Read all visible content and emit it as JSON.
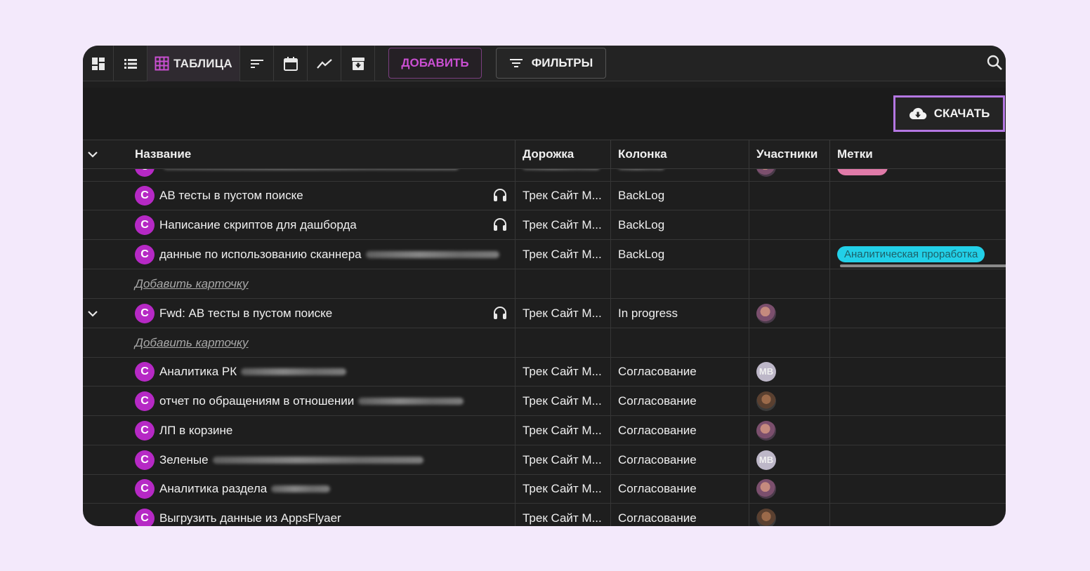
{
  "toolbar": {
    "table_label": "ТАБЛИЦА",
    "add_label": "ДОБАВИТЬ",
    "filters_label": "ФИЛЬТРЫ"
  },
  "download_label": "СКАЧАТЬ",
  "columns": {
    "name": "Название",
    "lane": "Дорожка",
    "column": "Колонка",
    "members": "Участники",
    "tags": "Метки"
  },
  "avatar_letter": "C",
  "rows": [
    {
      "title": "АВ тесты в пустом поиске",
      "lane": "Трек Сайт М...",
      "column": "BackLog"
    },
    {
      "title": "Написание скриптов для дашборда",
      "lane": "Трек Сайт М...",
      "column": "BackLog"
    },
    {
      "title": "данные по использованию сканнера",
      "lane": "Трек Сайт М...",
      "column": "BackLog",
      "tag": "Аналитическая проработка"
    },
    {
      "add_card": "Добавить карточку"
    },
    {
      "title": "Fwd: АВ тесты в пустом поиске",
      "lane": "Трек Сайт М...",
      "column": "In progress"
    },
    {
      "add_card": "Добавить карточку"
    },
    {
      "title": "Аналитика РК",
      "lane": "Трек Сайт М...",
      "column": "Согласование"
    },
    {
      "title": "отчет по обращениям в отношении",
      "lane": "Трек Сайт М...",
      "column": "Согласование"
    },
    {
      "title": "ЛП в корзине",
      "lane": "Трек Сайт М...",
      "column": "Согласование"
    },
    {
      "title": "Зеленые",
      "lane": "Трек Сайт М...",
      "column": "Согласование"
    },
    {
      "title": "Аналитика раздела",
      "lane": "Трек Сайт М...",
      "column": "Согласование"
    },
    {
      "title": "Выгрузить данные из AppsFlyaer",
      "lane": "Трек Сайт М...",
      "column": "Согласование"
    }
  ],
  "member_initials": "МВ",
  "colors": {
    "accent": "#b629c5",
    "tag": "#22d0e8",
    "highlight": "#b477e2"
  }
}
